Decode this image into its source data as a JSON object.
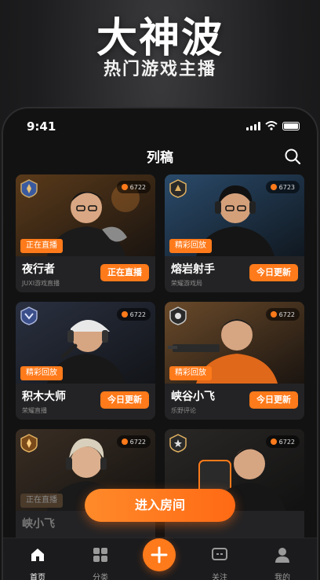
{
  "hero": {
    "title": "大神波",
    "subtitle": "热门游戏主播"
  },
  "status_bar": {
    "time": "9:41"
  },
  "nav": {
    "title": "列稿"
  },
  "cards": [
    {
      "name": "夜行者",
      "tag": "正在直播",
      "viewers": "6722",
      "sub": "JUXI游戏直播",
      "button": "正在直播"
    },
    {
      "name": "熔岩射手",
      "tag": "精彩回放",
      "viewers": "6723",
      "sub": "荣耀游戏局",
      "button": "今日更新"
    },
    {
      "name": "积木大师",
      "tag": "精彩回放",
      "viewers": "6722",
      "sub": "荣耀直播",
      "button": "今日更新"
    },
    {
      "name": "峡谷小飞",
      "tag": "精彩回放",
      "viewers": "6722",
      "sub": "乐野评论",
      "button": "今日更新"
    },
    {
      "name": "峡小飞",
      "tag": "正在直播",
      "viewers": "6722",
      "sub": "",
      "button": ""
    },
    {
      "name": "",
      "tag": "",
      "viewers": "6722",
      "sub": "",
      "button": ""
    }
  ],
  "enter_button": "进入房间",
  "tabs": [
    {
      "label": "首页",
      "icon": "home-icon",
      "active": true
    },
    {
      "label": "分类",
      "icon": "grid-icon",
      "active": false
    },
    {
      "label": "",
      "icon": "plus-icon",
      "active": false
    },
    {
      "label": "关注",
      "icon": "chat-icon",
      "active": false
    },
    {
      "label": "我的",
      "icon": "user-icon",
      "active": false
    }
  ],
  "colors": {
    "accent": "#ff7a1a",
    "background": "#121212",
    "card": "#232325"
  }
}
